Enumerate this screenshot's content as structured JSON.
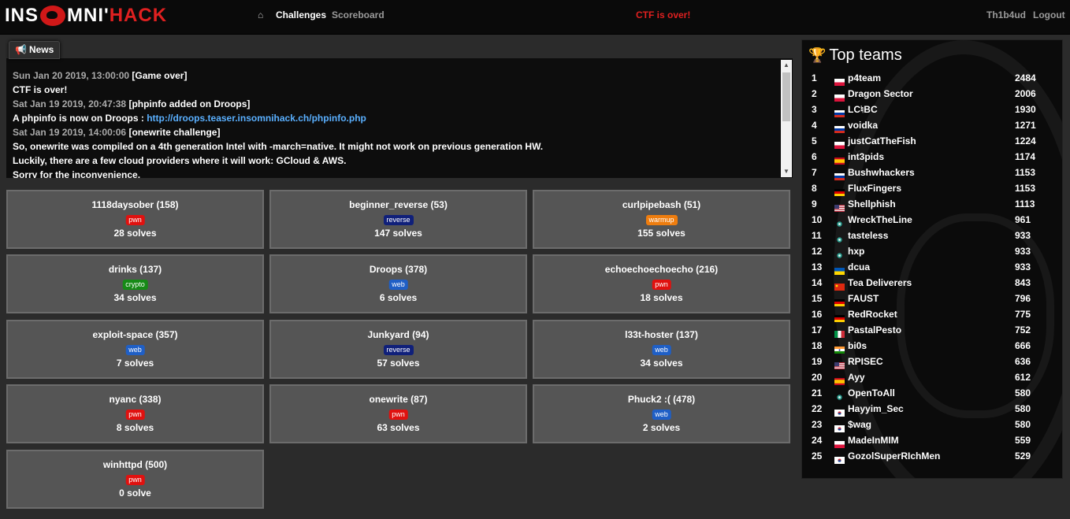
{
  "nav": {
    "logo_left": "INS",
    "logo_mid": "MNI'",
    "logo_right": "HACK",
    "home_icon": "⌂",
    "challenges": "Challenges",
    "scoreboard": "Scoreboard",
    "status": "CTF is over!",
    "user": "Th1b4ud",
    "logout": "Logout"
  },
  "news": {
    "tab_label": "News",
    "lines": [
      {
        "date": "Sun Jan 20 2019, 13:00:00",
        "text": " [Game over]"
      },
      {
        "date": "",
        "text": "CTF is over!"
      },
      {
        "date": "Sat Jan 19 2019, 20:47:38",
        "text": " [phpinfo added on Droops]"
      },
      {
        "date": "",
        "text": "A phpinfo is now on Droops : ",
        "link": "http://droops.teaser.insomnihack.ch/phpinfo.php"
      },
      {
        "date": "Sat Jan 19 2019, 14:00:06",
        "text": " [onewrite challenge]"
      },
      {
        "date": "",
        "text": "So, onewrite was compiled on a 4th generation Intel with -march=native. It might not work on previous generation HW."
      },
      {
        "date": "",
        "text": "Luckily, there are a few cloud providers where it will work: GCloud & AWS."
      },
      {
        "date": "",
        "text": "Sorry for the inconvenience."
      }
    ]
  },
  "tag_colors": {
    "pwn": "#e0110f",
    "reverse": "#10207a",
    "warmup": "#ef7d0e",
    "crypto": "#168a16",
    "web": "#1f5fc6"
  },
  "challenges": [
    {
      "name": "1118daysober (158)",
      "tag": "pwn",
      "solves": "28 solves"
    },
    {
      "name": "beginner_reverse (53)",
      "tag": "reverse",
      "solves": "147 solves"
    },
    {
      "name": "curlpipebash (51)",
      "tag": "warmup",
      "solves": "155 solves"
    },
    {
      "name": "drinks (137)",
      "tag": "crypto",
      "solves": "34 solves"
    },
    {
      "name": "Droops (378)",
      "tag": "web",
      "solves": "6 solves"
    },
    {
      "name": "echoechoechoecho (216)",
      "tag": "pwn",
      "solves": "18 solves"
    },
    {
      "name": "exploit-space (357)",
      "tag": "web",
      "solves": "7 solves"
    },
    {
      "name": "Junkyard (94)",
      "tag": "reverse",
      "solves": "57 solves"
    },
    {
      "name": "l33t-hoster (137)",
      "tag": "web",
      "solves": "34 solves"
    },
    {
      "name": "nyanc (338)",
      "tag": "pwn",
      "solves": "8 solves"
    },
    {
      "name": "onewrite (87)",
      "tag": "pwn",
      "solves": "63 solves"
    },
    {
      "name": "Phuck2 :( (478)",
      "tag": "web",
      "solves": "2 solves"
    },
    {
      "name": "winhttpd (500)",
      "tag": "pwn",
      "solves": "0 solve"
    }
  ],
  "top_teams": {
    "title": "Top teams",
    "teams": [
      {
        "rank": "1",
        "name": "p4team",
        "score": "2484",
        "flag": "pl"
      },
      {
        "rank": "2",
        "name": "Dragon Sector",
        "score": "2006",
        "flag": "pl"
      },
      {
        "rank": "3",
        "name": "LC♮BC",
        "score": "1930",
        "flag": "ru"
      },
      {
        "rank": "4",
        "name": "voidka",
        "score": "1271",
        "flag": "ru"
      },
      {
        "rank": "5",
        "name": "justCatTheFish",
        "score": "1224",
        "flag": "pl"
      },
      {
        "rank": "6",
        "name": "int3pids",
        "score": "1174",
        "flag": "es"
      },
      {
        "rank": "7",
        "name": "Bushwhackers",
        "score": "1153",
        "flag": "ru"
      },
      {
        "rank": "8",
        "name": "FluxFingers",
        "score": "1153",
        "flag": "de"
      },
      {
        "rank": "9",
        "name": "Shellphish",
        "score": "1113",
        "flag": "us"
      },
      {
        "rank": "10",
        "name": "WreckTheLine",
        "score": "961",
        "flag": "other"
      },
      {
        "rank": "11",
        "name": "tasteless",
        "score": "933",
        "flag": "other"
      },
      {
        "rank": "12",
        "name": "hxp",
        "score": "933",
        "flag": "other"
      },
      {
        "rank": "13",
        "name": "dcua",
        "score": "933",
        "flag": "ua"
      },
      {
        "rank": "14",
        "name": "Tea Deliverers",
        "score": "843",
        "flag": "cn"
      },
      {
        "rank": "15",
        "name": "FAUST",
        "score": "796",
        "flag": "de"
      },
      {
        "rank": "16",
        "name": "RedRocket",
        "score": "775",
        "flag": "de"
      },
      {
        "rank": "17",
        "name": "PastalPesto",
        "score": "752",
        "flag": "it"
      },
      {
        "rank": "18",
        "name": "bi0s",
        "score": "666",
        "flag": "in"
      },
      {
        "rank": "19",
        "name": "RPISEC",
        "score": "636",
        "flag": "us"
      },
      {
        "rank": "20",
        "name": "Ayy",
        "score": "612",
        "flag": "es"
      },
      {
        "rank": "21",
        "name": "OpenToAll",
        "score": "580",
        "flag": "other"
      },
      {
        "rank": "22",
        "name": "Hayyim_Sec",
        "score": "580",
        "flag": "kr"
      },
      {
        "rank": "23",
        "name": "$wag",
        "score": "580",
        "flag": "kr"
      },
      {
        "rank": "24",
        "name": "MadeInMIM",
        "score": "559",
        "flag": "pl"
      },
      {
        "rank": "25",
        "name": "GozolSuperRIchMen",
        "score": "529",
        "flag": "kr"
      }
    ]
  }
}
